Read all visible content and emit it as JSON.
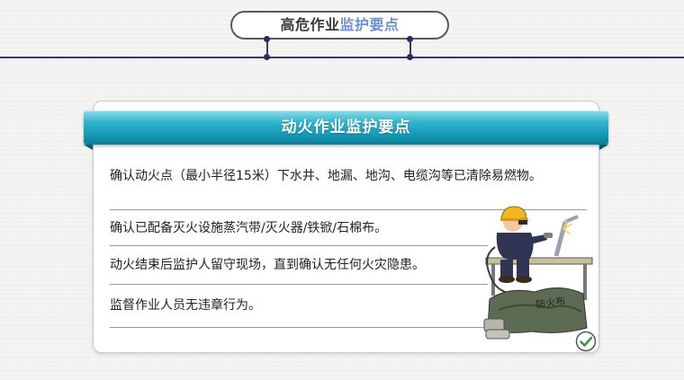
{
  "header": {
    "title_plain": "高危作业",
    "title_accent": "监护要点"
  },
  "card": {
    "banner_title": "动火作业监护要点",
    "items": [
      "确认动火点（最小半径15米）下水井、地漏、地沟、电缆沟等已清除易燃物。",
      "确认已配备灭火设施蒸汽带/灭火器/铁锨/石棉布。",
      "动火结束后监护人留守现场，直到确认无任何火灾隐患。",
      "监督作业人员无违章行为。"
    ],
    "illustration_label": "防火布"
  },
  "colors": {
    "banner": "#159ab8",
    "title_accent": "#6d8fd6",
    "line": "#3b3a63"
  },
  "icons": [
    "welder-illustration",
    "check-icon"
  ]
}
